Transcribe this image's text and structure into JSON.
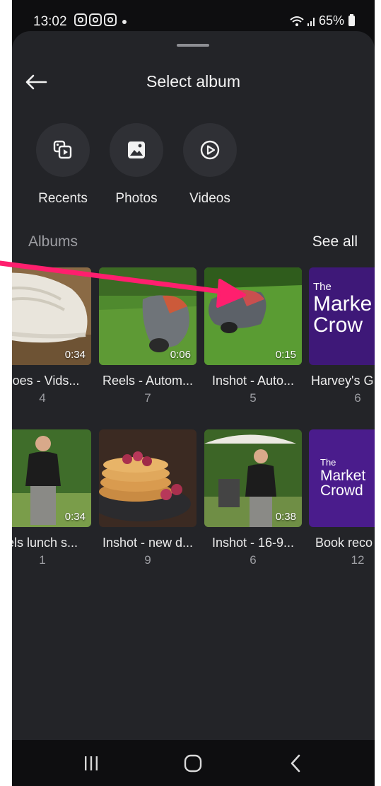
{
  "status": {
    "time": "13:02",
    "battery": "65%"
  },
  "sheet": {
    "title": "Select album"
  },
  "quick": [
    {
      "label": "Recents",
      "icon": "recents-icon"
    },
    {
      "label": "Photos",
      "icon": "photos-icon"
    },
    {
      "label": "Videos",
      "icon": "videos-icon"
    }
  ],
  "albums_section": {
    "label": "Albums",
    "see_all": "See all"
  },
  "albums": [
    {
      "name": "hoes - Vids...",
      "count": "4",
      "duration": "0:34"
    },
    {
      "name": "Reels - Autom...",
      "count": "7",
      "duration": "0:06"
    },
    {
      "name": "Inshot - Auto...",
      "count": "5",
      "duration": "0:15"
    },
    {
      "name": "Harvey's G",
      "count": "6",
      "duration": "",
      "thumb_text": [
        "The",
        "Marke",
        "Crow"
      ]
    },
    {
      "name": "els lunch s...",
      "count": "1",
      "duration": "0:34"
    },
    {
      "name": "Inshot - new d...",
      "count": "9",
      "duration": ""
    },
    {
      "name": "Inshot - 16-9...",
      "count": "6",
      "duration": "0:38"
    },
    {
      "name": "Book reco",
      "count": "12",
      "duration": "",
      "thumb_text": [
        "The",
        "Market",
        "Crowd"
      ]
    }
  ],
  "colors": {
    "annotation_arrow": "#ff1f6e",
    "sheet_bg": "#232428",
    "accent_purple": "#4a1c8c"
  }
}
